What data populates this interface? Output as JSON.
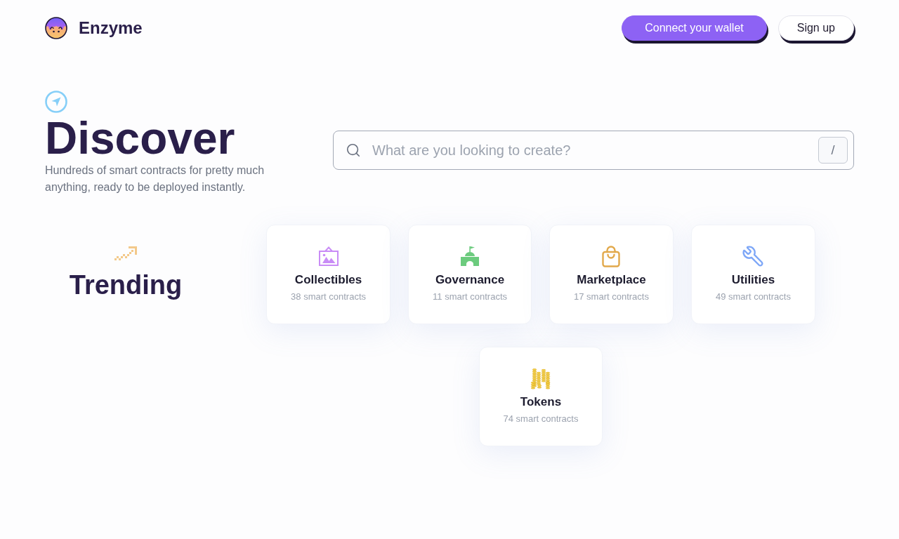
{
  "header": {
    "brand": "Enzyme",
    "buttons": [
      {
        "label": "Connect your wallet",
        "kind": "primary"
      },
      {
        "label": "Sign up",
        "kind": "secondary"
      }
    ]
  },
  "hero": {
    "title": "Discover",
    "subtitle": "Hundreds of smart contracts for pretty much anything, ready to be deployed instantly."
  },
  "search": {
    "placeholder": "What are you looking to create?",
    "shortcut": "/"
  },
  "trending": {
    "title": "Trending",
    "categories": [
      {
        "name": "Collectibles",
        "count": "38 smart contracts"
      },
      {
        "name": "Governance",
        "count": "11 smart contracts"
      },
      {
        "name": "Marketplace",
        "count": "17 smart contracts"
      },
      {
        "name": "Utilities",
        "count": "49 smart contracts"
      },
      {
        "name": "Tokens",
        "count": "74 smart contracts"
      }
    ]
  }
}
